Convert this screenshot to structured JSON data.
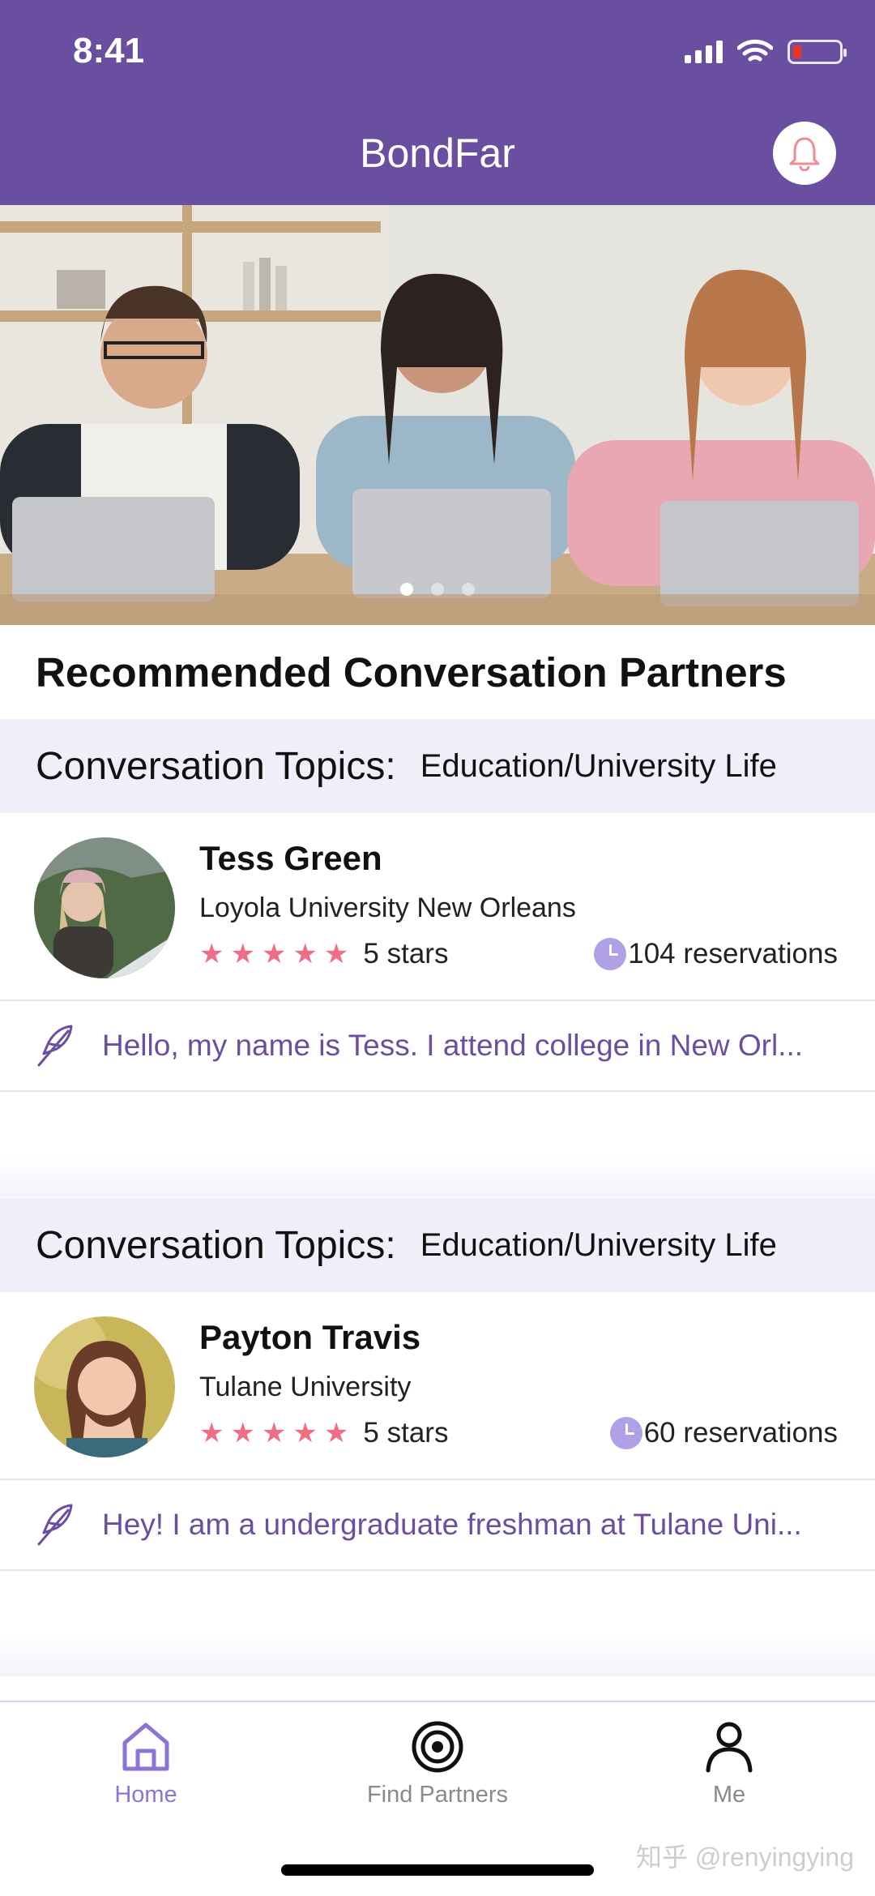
{
  "status_bar": {
    "time": "8:41"
  },
  "header": {
    "title": "BondFar"
  },
  "hero": {
    "slide_count": 3,
    "active_slide": 1
  },
  "section_title": "Recommended Conversation Partners",
  "topics_label": "Conversation Topics:",
  "partners": [
    {
      "topic": "Education/University Life",
      "name": "Tess Green",
      "school": "Loyola University New Orleans",
      "stars": "★★★★★",
      "rating_text": "5 stars",
      "reservations": "104 reservations",
      "intro": "Hello, my name is Tess. I attend college in New Orl..."
    },
    {
      "topic": "Education/University Life",
      "name": "Payton Travis",
      "school": "Tulane University",
      "stars": "★★★★★",
      "rating_text": "5 stars",
      "reservations": "60 reservations",
      "intro": "Hey! I am a undergraduate freshman at Tulane Uni..."
    }
  ],
  "nav": {
    "home": "Home",
    "find": "Find Partners",
    "me": "Me"
  },
  "watermark": "知乎 @renyingying",
  "colors": {
    "header": "#6a4fa0",
    "accent": "#8b74d6",
    "star": "#ee6e86",
    "topics_bg": "#f1eefa"
  }
}
